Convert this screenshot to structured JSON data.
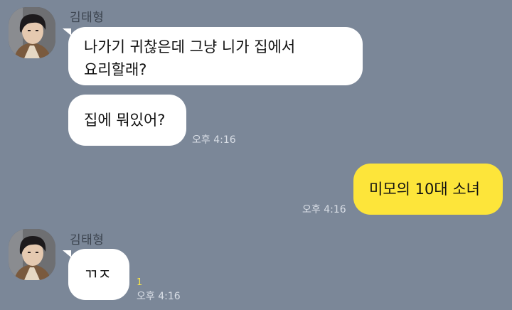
{
  "chat": {
    "messages": [
      {
        "sender": "김태형",
        "text": "나가기 귀찮은데 그냥 니가 집에서\n요리할래?"
      },
      {
        "text": "집에 뭐있어?",
        "time": "오후 4:16"
      },
      {
        "text": "미모의 10대 소녀",
        "time": "오후 4:16"
      },
      {
        "sender": "김태형",
        "text": "ㄲㅈ",
        "time": "오후 4:16",
        "unread": "1"
      }
    ]
  },
  "icons": {
    "avatar": "profile-photo-icon"
  },
  "colors": {
    "background": "#7b8798",
    "incoming_bubble": "#ffffff",
    "outgoing_bubble": "#fde53a",
    "unread_count": "#f7e34a"
  }
}
